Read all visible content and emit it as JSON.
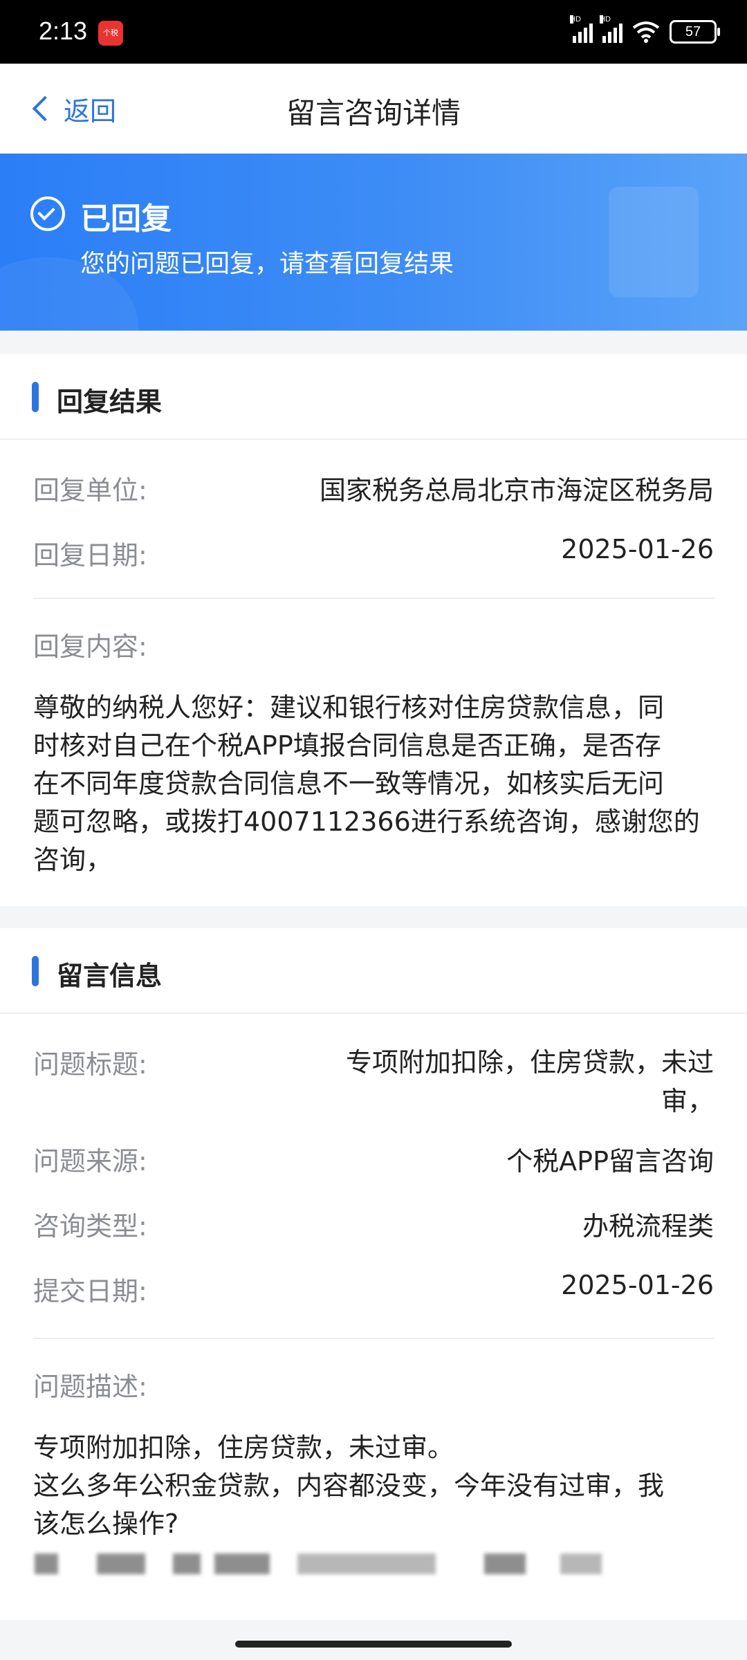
{
  "status_bar": {
    "time": "2:13",
    "notif_app": "个税",
    "hd1": "HD",
    "hd2": "HD",
    "battery": "57"
  },
  "nav": {
    "back_label": "返回",
    "title": "留言咨询详情"
  },
  "banner": {
    "status": "已回复",
    "message": "您的问题已回复，请查看回复结果"
  },
  "reply": {
    "section_title": "回复结果",
    "unit_label": "回复单位:",
    "unit_value": "国家税务总局北京市海淀区税务局",
    "date_label": "回复日期:",
    "date_value": "2025-01-26",
    "content_label": "回复内容:",
    "content_lines": [
      "尊敬的纳税人您好：建议和银行核对住房贷款信息，同",
      "时核对自己在个税APP填报合同信息是否正确，是否存",
      "在不同年度贷款合同信息不一致等情况，如核实后无问",
      "题可忽略，或拨打4007112366进行系统咨询，感谢您的",
      "咨询，"
    ]
  },
  "message": {
    "section_title": "留言信息",
    "title_label": "问题标题:",
    "title_value_line1": "专项附加扣除，住房贷款，未过",
    "title_value_line2": "审，",
    "source_label": "问题来源:",
    "source_value": "个税APP留言咨询",
    "type_label": "咨询类型:",
    "type_value": "办税流程类",
    "submit_label": "提交日期:",
    "submit_value": "2025-01-26",
    "desc_label": "问题描述:",
    "desc_lines": [
      "专项附加扣除，住房贷款，未过审。",
      "这么多年公积金贷款，内容都没变，今年没有过审，我",
      "该怎么操作?"
    ]
  },
  "colors": {
    "accent": "#2e74e0",
    "banner": "#2b7ef6",
    "label_gray": "#8a8d92"
  }
}
